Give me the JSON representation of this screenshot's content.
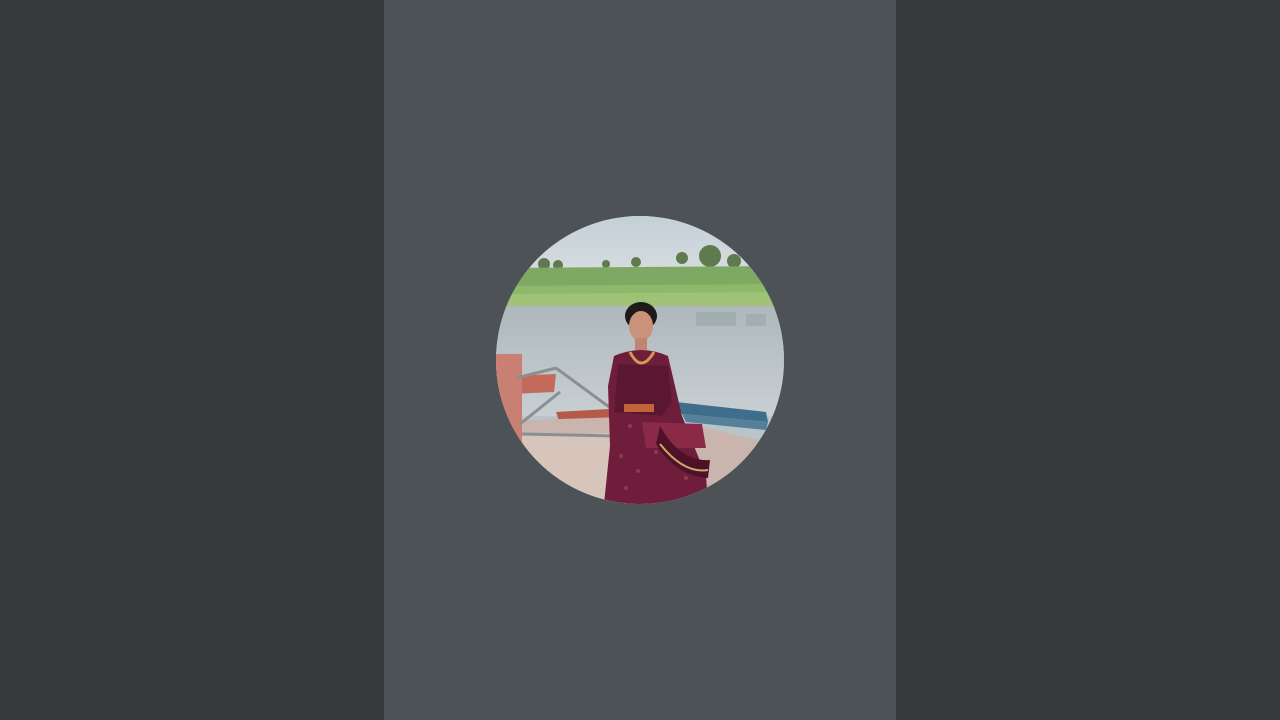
{
  "screen": {
    "background_color": "#36393c",
    "stage_color": "#4c5255"
  },
  "avatar": {
    "description_icon": "profile-photo-icon",
    "shape": "circle"
  }
}
